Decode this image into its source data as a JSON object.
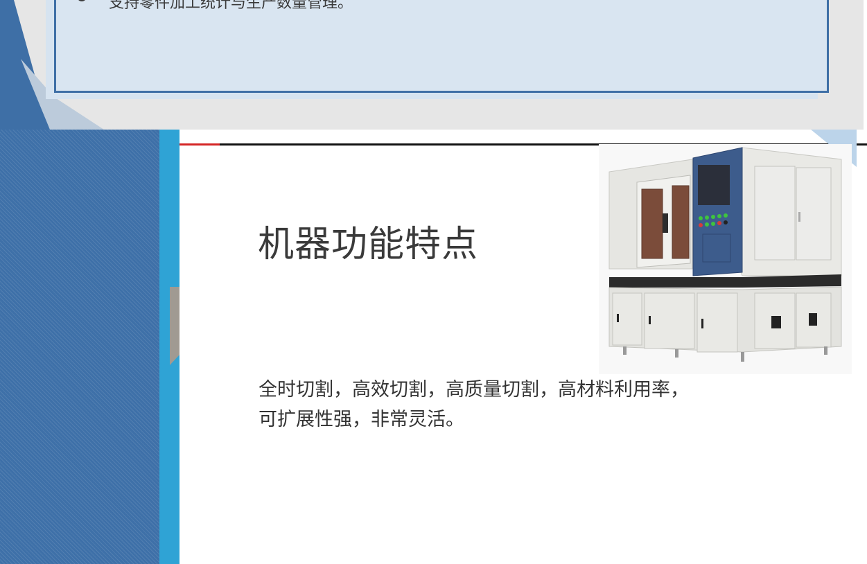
{
  "previous_slide": {
    "bullet_text": "支持零件加工统计与生产数量管理。"
  },
  "slide": {
    "title": "机器功能特点",
    "description_line1": "全时切割，高效切割，高质量切割，高材料利用率，",
    "description_line2": "可扩展性强，非常灵活。"
  },
  "colors": {
    "accent_red": "#d42424",
    "panel_blue": "#3f6fa6",
    "cyan_strip": "#2fa3d5",
    "stripe_blue": "#3e70a8"
  },
  "image": {
    "icon": "laser-cutting-machine-icon"
  }
}
